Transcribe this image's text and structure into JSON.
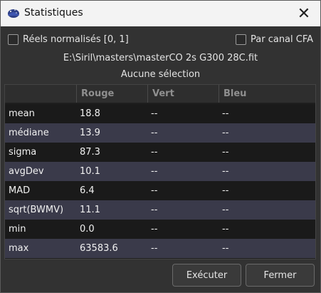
{
  "window": {
    "title": "Statistiques"
  },
  "options": {
    "normalized_label": "Réels normalisés [0, 1]",
    "per_channel_label": "Par canal CFA"
  },
  "file_path": "E:\\Siril\\masters\\masterCO 2s G300 28C.fit",
  "selection_text": "Aucune sélection",
  "table": {
    "headers": [
      "",
      "Rouge",
      "Vert",
      "Bleu"
    ],
    "rows": [
      [
        "mean",
        "18.8",
        "--",
        "--"
      ],
      [
        "médiane",
        "13.9",
        "--",
        "--"
      ],
      [
        "sigma",
        "87.3",
        "--",
        "--"
      ],
      [
        "avgDev",
        "10.1",
        "--",
        "--"
      ],
      [
        "MAD",
        "6.4",
        "--",
        "--"
      ],
      [
        "sqrt(BWMV)",
        "11.1",
        "--",
        "--"
      ],
      [
        "min",
        "0.0",
        "--",
        "--"
      ],
      [
        "max",
        "63583.6",
        "--",
        "--"
      ]
    ]
  },
  "buttons": {
    "execute": "Exécuter",
    "close": "Fermer"
  },
  "icons": {
    "app": "siril-icon",
    "close": "close-icon"
  }
}
